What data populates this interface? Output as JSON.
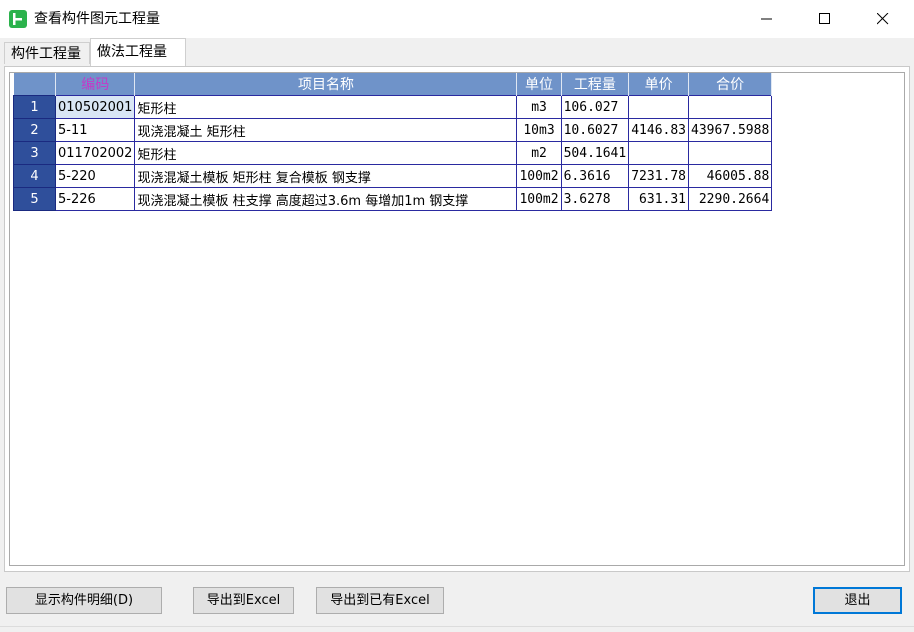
{
  "window": {
    "title": "查看构件图元工程量",
    "app_icon": "app-logo-icon",
    "accent_color": "#2bb24c"
  },
  "window_controls": {
    "minimize_icon": "minimize-icon",
    "maximize_icon": "maximize-icon",
    "close_icon": "close-icon"
  },
  "tabs": [
    {
      "label": "构件工程量",
      "active": false
    },
    {
      "label": "做法工程量",
      "active": true
    }
  ],
  "table": {
    "header_color": "#6f93c9",
    "columns": [
      "编码",
      "项目名称",
      "单位",
      "工程量",
      "单价",
      "合价"
    ],
    "rows": [
      {
        "num": "1",
        "code": "010502001",
        "name": "矩形柱",
        "unit": "m3",
        "qty": "106.027",
        "price": "",
        "total": ""
      },
      {
        "num": "2",
        "code": "5-11",
        "name": "现浇混凝土 矩形柱",
        "unit": "10m3",
        "qty": "10.6027",
        "price": "4146.83",
        "total": "43967.5988"
      },
      {
        "num": "3",
        "code": "011702002",
        "name": "矩形柱",
        "unit": "m2",
        "qty": "504.1641",
        "price": "",
        "total": ""
      },
      {
        "num": "4",
        "code": "5-220",
        "name": "现浇混凝土模板 矩形柱 复合模板 钢支撑",
        "unit": "100m2",
        "qty": "6.3616",
        "price": "7231.78",
        "total": "46005.88"
      },
      {
        "num": "5",
        "code": "5-226",
        "name": "现浇混凝土模板 柱支撑 高度超过3.6m 每增加1m 钢支撑",
        "unit": "100m2",
        "qty": "3.6278",
        "price": "631.31",
        "total": "2290.2664"
      }
    ]
  },
  "buttons": {
    "detail": "显示构件明细(D)",
    "export": "导出到Excel",
    "export_existing": "导出到已有Excel",
    "exit": "退出"
  }
}
